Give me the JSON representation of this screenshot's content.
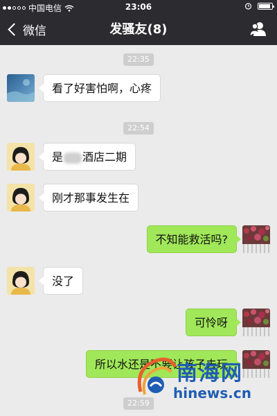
{
  "status_bar": {
    "carrier": "中国电信",
    "time": "23:06"
  },
  "nav": {
    "back_label": "微信",
    "title": "发骚友(8)"
  },
  "timestamps": [
    "22:35",
    "22:54",
    "22:59"
  ],
  "messages": [
    {
      "side": "left",
      "avatar": "ocean-photo-avatar",
      "text": "看了好害怕啊，心疼"
    },
    {
      "side": "left",
      "avatar": "cartoon-girl-avatar",
      "text_before": "是",
      "text_after": "酒店二期"
    },
    {
      "side": "left",
      "avatar": "cartoon-girl-avatar",
      "text": "刚才那事发生在"
    },
    {
      "side": "right",
      "avatar": "flowers-photo-avatar",
      "text": "不知能救活吗?"
    },
    {
      "side": "left",
      "avatar": "cartoon-girl-avatar",
      "text": "没了"
    },
    {
      "side": "right",
      "avatar": "flowers-photo-avatar",
      "text": "可怜呀"
    },
    {
      "side": "right",
      "avatar": "flowers-photo-avatar",
      "text": "所以水还是不要让孩子去玩"
    }
  ],
  "watermark": {
    "name": "南海网",
    "url": "hinews.cn"
  },
  "colors": {
    "header_bg": "#2b2b30",
    "chat_bg": "#ebebeb",
    "bubble_self": "#a0e759",
    "bubble_other": "#ffffff",
    "watermark_blue": "#1f5db3"
  }
}
